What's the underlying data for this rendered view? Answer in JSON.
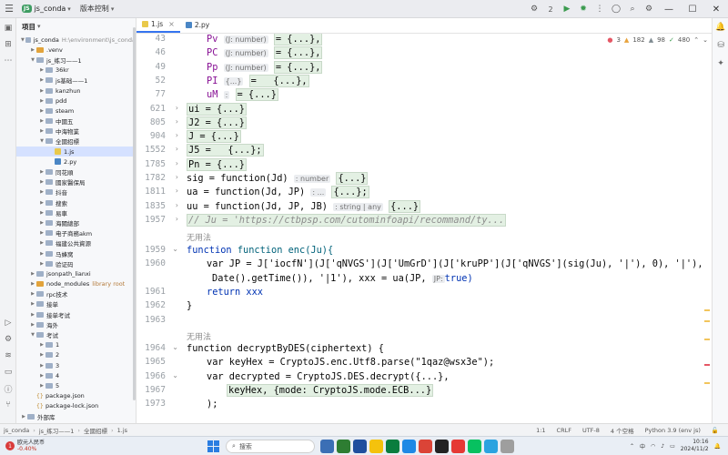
{
  "titlebar": {
    "project_badge": "JS",
    "project_name": "js_conda",
    "vcs_label": "版本控制",
    "run_config_count": "2"
  },
  "project_panel": {
    "title": "项目",
    "tree": [
      {
        "label": "js_conda",
        "hint": "H:\\environment\\js_conda",
        "depth": 0,
        "kind": "folder",
        "open": true
      },
      {
        "label": ".venv",
        "hint": "",
        "depth": 1,
        "kind": "folder-orange",
        "open": false
      },
      {
        "label": "js_练习——1",
        "hint": "",
        "depth": 1,
        "kind": "folder",
        "open": true
      },
      {
        "label": "36kr",
        "hint": "",
        "depth": 2,
        "kind": "folder",
        "open": false
      },
      {
        "label": "js基础——1",
        "hint": "",
        "depth": 2,
        "kind": "folder",
        "open": false
      },
      {
        "label": "kanzhun",
        "hint": "",
        "depth": 2,
        "kind": "folder",
        "open": false
      },
      {
        "label": "pdd",
        "hint": "",
        "depth": 2,
        "kind": "folder",
        "open": false
      },
      {
        "label": "steam",
        "hint": "",
        "depth": 2,
        "kind": "folder",
        "open": false
      },
      {
        "label": "中國五",
        "hint": "",
        "depth": 2,
        "kind": "folder",
        "open": false
      },
      {
        "label": "中海物業",
        "hint": "",
        "depth": 2,
        "kind": "folder",
        "open": false
      },
      {
        "label": "全國招標",
        "hint": "",
        "depth": 2,
        "kind": "folder",
        "open": true
      },
      {
        "label": "1.js",
        "hint": "",
        "depth": 3,
        "kind": "js",
        "open": false,
        "selected": true
      },
      {
        "label": "2.py",
        "hint": "",
        "depth": 3,
        "kind": "py",
        "open": false
      },
      {
        "label": "同花順",
        "hint": "",
        "depth": 2,
        "kind": "folder",
        "open": false
      },
      {
        "label": "國家醫保局",
        "hint": "",
        "depth": 2,
        "kind": "folder",
        "open": false
      },
      {
        "label": "抖音",
        "hint": "",
        "depth": 2,
        "kind": "folder",
        "open": false
      },
      {
        "label": "搜索",
        "hint": "",
        "depth": 2,
        "kind": "folder",
        "open": false
      },
      {
        "label": "易車",
        "hint": "",
        "depth": 2,
        "kind": "folder",
        "open": false
      },
      {
        "label": "海關總部",
        "hint": "",
        "depth": 2,
        "kind": "folder",
        "open": false
      },
      {
        "label": "电子商務akm",
        "hint": "",
        "depth": 2,
        "kind": "folder",
        "open": false
      },
      {
        "label": "福建公共資源",
        "hint": "",
        "depth": 2,
        "kind": "folder",
        "open": false
      },
      {
        "label": "马蜂窝",
        "hint": "",
        "depth": 2,
        "kind": "folder",
        "open": false
      },
      {
        "label": "验证码",
        "hint": "",
        "depth": 2,
        "kind": "folder",
        "open": false
      },
      {
        "label": "jsonpath_lianxi",
        "hint": "",
        "depth": 1,
        "kind": "folder",
        "open": false
      },
      {
        "label": "node_modules",
        "hint": "library root",
        "depth": 1,
        "kind": "folder-orange",
        "open": false
      },
      {
        "label": "rpc技术",
        "hint": "",
        "depth": 1,
        "kind": "folder",
        "open": false
      },
      {
        "label": "接单",
        "hint": "",
        "depth": 1,
        "kind": "folder",
        "open": false
      },
      {
        "label": "接单考试",
        "hint": "",
        "depth": 1,
        "kind": "folder",
        "open": false
      },
      {
        "label": "海外",
        "hint": "",
        "depth": 1,
        "kind": "folder",
        "open": false
      },
      {
        "label": "考试",
        "hint": "",
        "depth": 1,
        "kind": "folder",
        "open": true
      },
      {
        "label": "1",
        "hint": "",
        "depth": 2,
        "kind": "folder",
        "open": false
      },
      {
        "label": "2",
        "hint": "",
        "depth": 2,
        "kind": "folder",
        "open": false
      },
      {
        "label": "3",
        "hint": "",
        "depth": 2,
        "kind": "folder",
        "open": false
      },
      {
        "label": "4",
        "hint": "",
        "depth": 2,
        "kind": "folder",
        "open": false
      },
      {
        "label": "5",
        "hint": "",
        "depth": 2,
        "kind": "folder",
        "open": false
      },
      {
        "label": "package.json",
        "hint": "",
        "depth": 1,
        "kind": "json",
        "open": false
      },
      {
        "label": "package-lock.json",
        "hint": "",
        "depth": 1,
        "kind": "json",
        "open": false
      },
      {
        "label": "外部库",
        "hint": "",
        "depth": 0,
        "kind": "folder",
        "open": false
      }
    ]
  },
  "editor": {
    "tabs": [
      {
        "label": "1.js",
        "active": true
      },
      {
        "label": "2.py",
        "active": false
      }
    ],
    "inspections": {
      "errors": "3",
      "warnings": "182",
      "weak": "98",
      "ok": "480"
    },
    "line_numbers": [
      "43",
      "46",
      "49",
      "52",
      "77",
      "621",
      "805",
      "904",
      "1552",
      "1785",
      "1782",
      "1811",
      "1835",
      "1957",
      "",
      "1959",
      "1960",
      "",
      "1961",
      "1962",
      "1963",
      "",
      "1964",
      "1965",
      "1966",
      "1967",
      "1973"
    ],
    "no_method_label": "无用法",
    "lines": {
      "l1": {
        "name": "Pv",
        "hint": "(J: number)",
        "rest": "= {...},"
      },
      "l2": {
        "name": "PC",
        "hint": "(J: number)",
        "rest": "= {...},"
      },
      "l3": {
        "name": "Pp",
        "hint": "(J: number)",
        "rest": "= {...},"
      },
      "l4": {
        "name": "PI",
        "hint": "{...}",
        "rest": "=   {...},"
      },
      "l5": {
        "name": "uM",
        "hint": ":",
        "rest": "= {...}"
      },
      "l6": "ui = {...}",
      "l7": "J2 = {...}",
      "l8": "J = {...}",
      "l9": "J5 =   {...};",
      "l10": "Pn = {...}",
      "l11a": "sig = function(Jd)",
      "l11hint": ": number",
      "l11b": "{...}",
      "l12a": "ua = function(Jd, JP)",
      "l12hint": ": ...",
      "l12b": "{...};",
      "l13a": "uu = function(Jd, JP, JB)",
      "l13hint": ": string | any",
      "l13b": "{...}",
      "l14": "// Ju = 'https://ctbpsp.com/cutominfoapi/recommand/ty...",
      "l15": "function enc(Ju){",
      "l16a": "var JP = J['iocfN'](J['qNVGS'](J['UmGrD'](J['kruPP'](J['qNVGS'](sig(Ju), '|'), 0), '|'), new",
      "l16b": "Date().getTime()), '|1'), xxx = ua(JP,",
      "l16hint": "JP:",
      "l16c": "true)",
      "l17": "return xxx",
      "l18": "}",
      "l19": "function decryptByDES(ciphertext) {",
      "l20": "var keyHex = CryptoJS.enc.Utf8.parse(\"1qaz@wsx3e\");",
      "l21": "var decrypted = CryptoJS.DES.decrypt({...},",
      "l22": "keyHex, {mode: CryptoJS.mode.ECB...}",
      "l23": ");"
    }
  },
  "statusbar": {
    "crumbs": [
      "js_conda",
      "js_练习——1",
      "全國招標",
      "1.js"
    ],
    "position": "1:1",
    "line_sep": "CRLF",
    "encoding": "UTF-8",
    "indent": "4 个空格",
    "interpreter": "Python 3.9 (env js)"
  },
  "taskbar": {
    "weather_badge": "1",
    "weather_title": "欧元人民币",
    "weather_value": "-0.40%",
    "search_placeholder": "搜索",
    "time": "10:16",
    "date": "2024/11/2"
  },
  "colors": {
    "accent": "#3574f0",
    "keyword": "#0033b3",
    "string": "#067d17",
    "variable": "#871094",
    "selection": "#d5e1ff"
  }
}
